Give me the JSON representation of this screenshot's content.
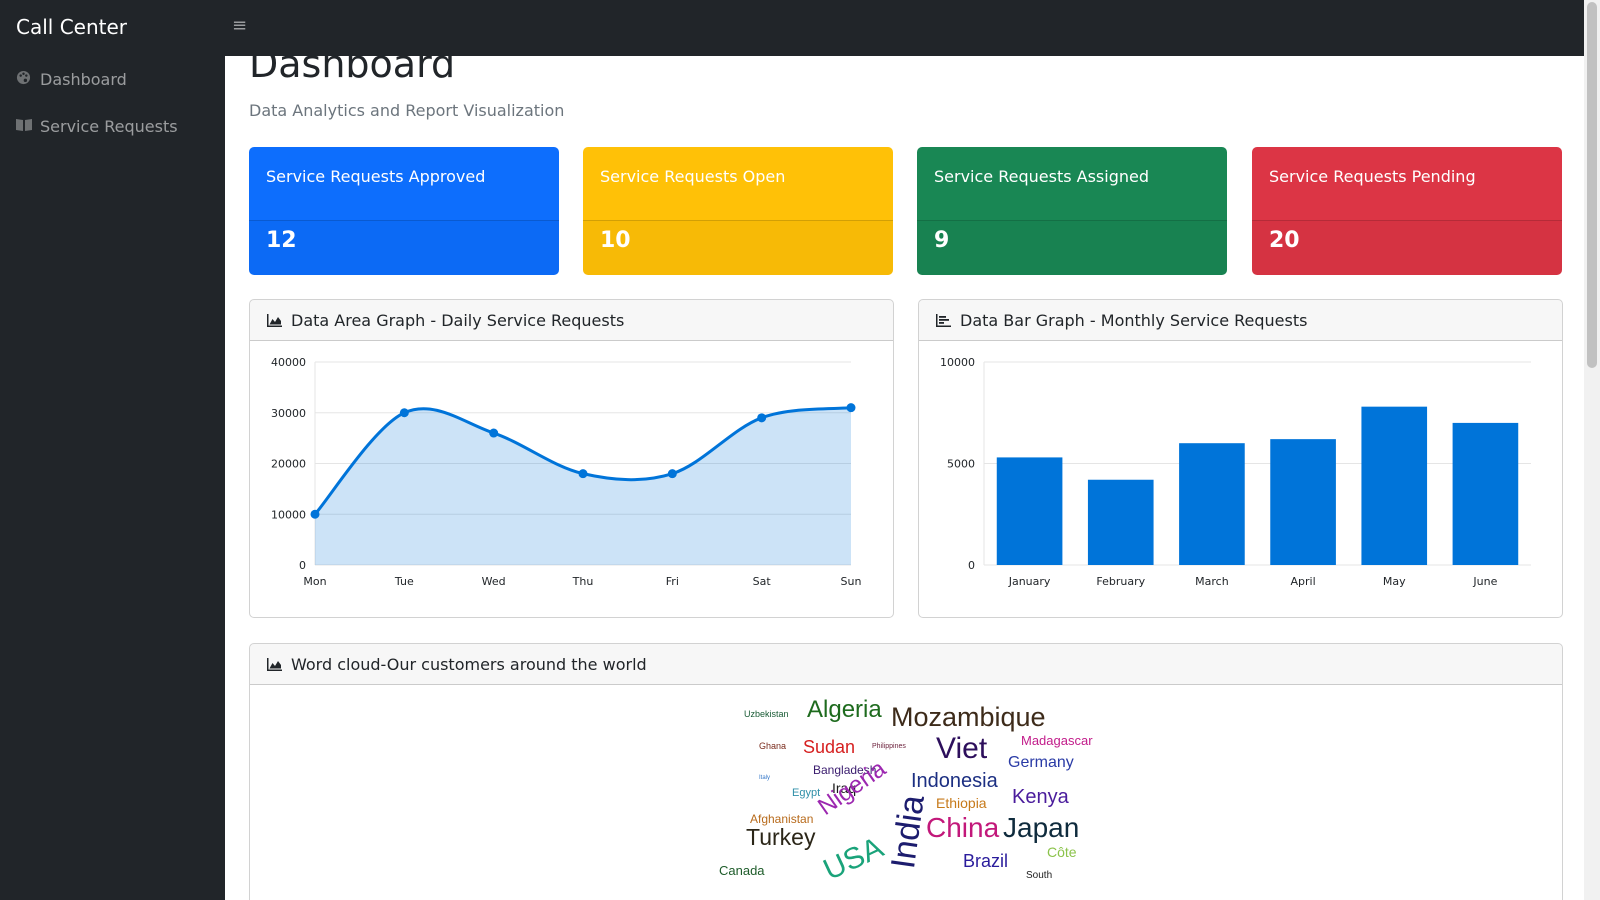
{
  "app": {
    "brand": "Call Center",
    "menu_icon": "hamburger-icon"
  },
  "sidebar": {
    "items": [
      {
        "label": "Dashboard",
        "icon": "palette-icon"
      },
      {
        "label": "Service Requests",
        "icon": "book-icon"
      }
    ]
  },
  "page": {
    "title": "Dashboard",
    "subtitle": "Data Analytics and Report Visualization"
  },
  "stats": [
    {
      "label": "Service Requests Approved",
      "value": "12",
      "color": "#0d6efd"
    },
    {
      "label": "Service Requests Open",
      "value": "10",
      "color": "#ffc107"
    },
    {
      "label": "Service Requests Assigned",
      "value": "9",
      "color": "#198754"
    },
    {
      "label": "Service Requests Pending",
      "value": "20",
      "color": "#dc3545"
    }
  ],
  "area_panel": {
    "title": "Data Area Graph - Daily Service Requests",
    "icon": "area-chart-icon"
  },
  "bar_panel": {
    "title": "Data Bar Graph - Monthly Service Requests",
    "icon": "bar-chart-icon"
  },
  "cloud_panel": {
    "title": "Word cloud-Our customers around the world",
    "icon": "area-chart-icon"
  },
  "chart_data": [
    {
      "type": "area",
      "categories": [
        "Mon",
        "Tue",
        "Wed",
        "Thu",
        "Fri",
        "Sat",
        "Sun"
      ],
      "values": [
        10000,
        30000,
        26000,
        18000,
        18000,
        29000,
        31000
      ],
      "ylim": [
        0,
        40000
      ],
      "yticks": [
        0,
        10000,
        20000,
        30000,
        40000
      ],
      "grid": true,
      "color": "#0074d9"
    },
    {
      "type": "bar",
      "categories": [
        "January",
        "February",
        "March",
        "April",
        "May",
        "June"
      ],
      "values": [
        5300,
        4200,
        6000,
        6200,
        7800,
        7000
      ],
      "ylim": [
        0,
        10000
      ],
      "yticks": [
        0,
        5000,
        10000
      ],
      "grid": true,
      "color": "#0074d9"
    }
  ],
  "word_cloud": [
    {
      "text": "Uzbekistan",
      "color": "#1a5c36"
    },
    {
      "text": "Algeria",
      "color": "#1e6b1e"
    },
    {
      "text": "Mozambique",
      "color": "#3d2b1a"
    },
    {
      "text": "Ghana",
      "color": "#7a2b1c"
    },
    {
      "text": "Sudan",
      "color": "#d62020"
    },
    {
      "text": "Philippines",
      "color": "#6b1f3a"
    },
    {
      "text": "Viet",
      "color": "#2d0f5c"
    },
    {
      "text": "Madagascar",
      "color": "#c21c8a"
    },
    {
      "text": "Germany",
      "color": "#2a3ba6"
    },
    {
      "text": "Bangladesh",
      "color": "#3a1c6e"
    },
    {
      "text": "Indonesia",
      "color": "#1c2f82"
    },
    {
      "text": "Italy",
      "color": "#3578c9"
    },
    {
      "text": "Egypt",
      "color": "#2f8fa8"
    },
    {
      "text": "Iraq",
      "color": "#1c1c1c"
    },
    {
      "text": "Nigeria",
      "color": "#9c27b0"
    },
    {
      "text": "Ethiopia",
      "color": "#c77a1a"
    },
    {
      "text": "Kenya",
      "color": "#4a1c9c"
    },
    {
      "text": "Afghanistan",
      "color": "#b86b1c"
    },
    {
      "text": "Turkey",
      "color": "#2b2618"
    },
    {
      "text": "India",
      "color": "#1c1c6e"
    },
    {
      "text": "China",
      "color": "#c2187a"
    },
    {
      "text": "Japan",
      "color": "#0f2b3d"
    },
    {
      "text": "USA",
      "color": "#1aa37a"
    },
    {
      "text": "Côte",
      "color": "#8bc34a"
    },
    {
      "text": "Canada",
      "color": "#1e5c2a"
    },
    {
      "text": "Brazil",
      "color": "#2a1c9c"
    },
    {
      "text": "South",
      "color": "#1c1c1c"
    }
  ]
}
